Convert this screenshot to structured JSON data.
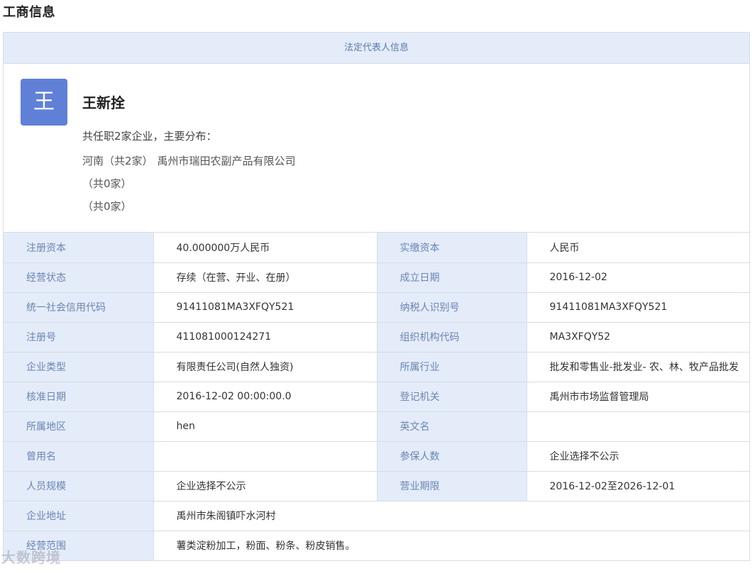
{
  "page_title": "工商信息",
  "panel_header": "法定代表人信息",
  "rep": {
    "avatar_char": "王",
    "name": "王新拴",
    "summary": "共任职2家企业，主要分布：",
    "distribution": [
      {
        "region": "河南（共2家）",
        "company": "禹州市瑞田农副产品有限公司"
      },
      {
        "region": "（共0家）",
        "company": ""
      },
      {
        "region": "（共0家）",
        "company": ""
      }
    ]
  },
  "info_rows": [
    {
      "l1": "注册资本",
      "v1": "40.000000万人民币",
      "l2": "实缴资本",
      "v2": "人民币"
    },
    {
      "l1": "经营状态",
      "v1": "存续（在营、开业、在册）",
      "l2": "成立日期",
      "v2": "2016-12-02"
    },
    {
      "l1": "统一社会信用代码",
      "v1": "91411081MA3XFQY521",
      "l2": "纳税人识别号",
      "v2": "91411081MA3XFQY521"
    },
    {
      "l1": "注册号",
      "v1": "411081000124271",
      "l2": "组织机构代码",
      "v2": "MA3XFQY52"
    },
    {
      "l1": "企业类型",
      "v1": "有限责任公司(自然人独资)",
      "l2": "所属行业",
      "v2": "批发和零售业-批发业- 农、林、牧产品批发"
    },
    {
      "l1": "核准日期",
      "v1": "2016-12-02 00:00:00.0",
      "l2": "登记机关",
      "v2": "禹州市市场监督管理局"
    },
    {
      "l1": "所属地区",
      "v1": "hen",
      "l2": "英文名",
      "v2": ""
    },
    {
      "l1": "曾用名",
      "v1": "",
      "l2": "参保人数",
      "v2": "企业选择不公示"
    },
    {
      "l1": "人员规模",
      "v1": "企业选择不公示",
      "l2": "营业期限",
      "v2": "2016-12-02至2026-12-01"
    }
  ],
  "address": {
    "label": "企业地址",
    "value": "禹州市朱阁镇吓水河村"
  },
  "scope": {
    "label": "经营范围",
    "value": "薯类淀粉加工，粉面、粉条、粉皮销售。"
  },
  "watermark": "大数跨境"
}
